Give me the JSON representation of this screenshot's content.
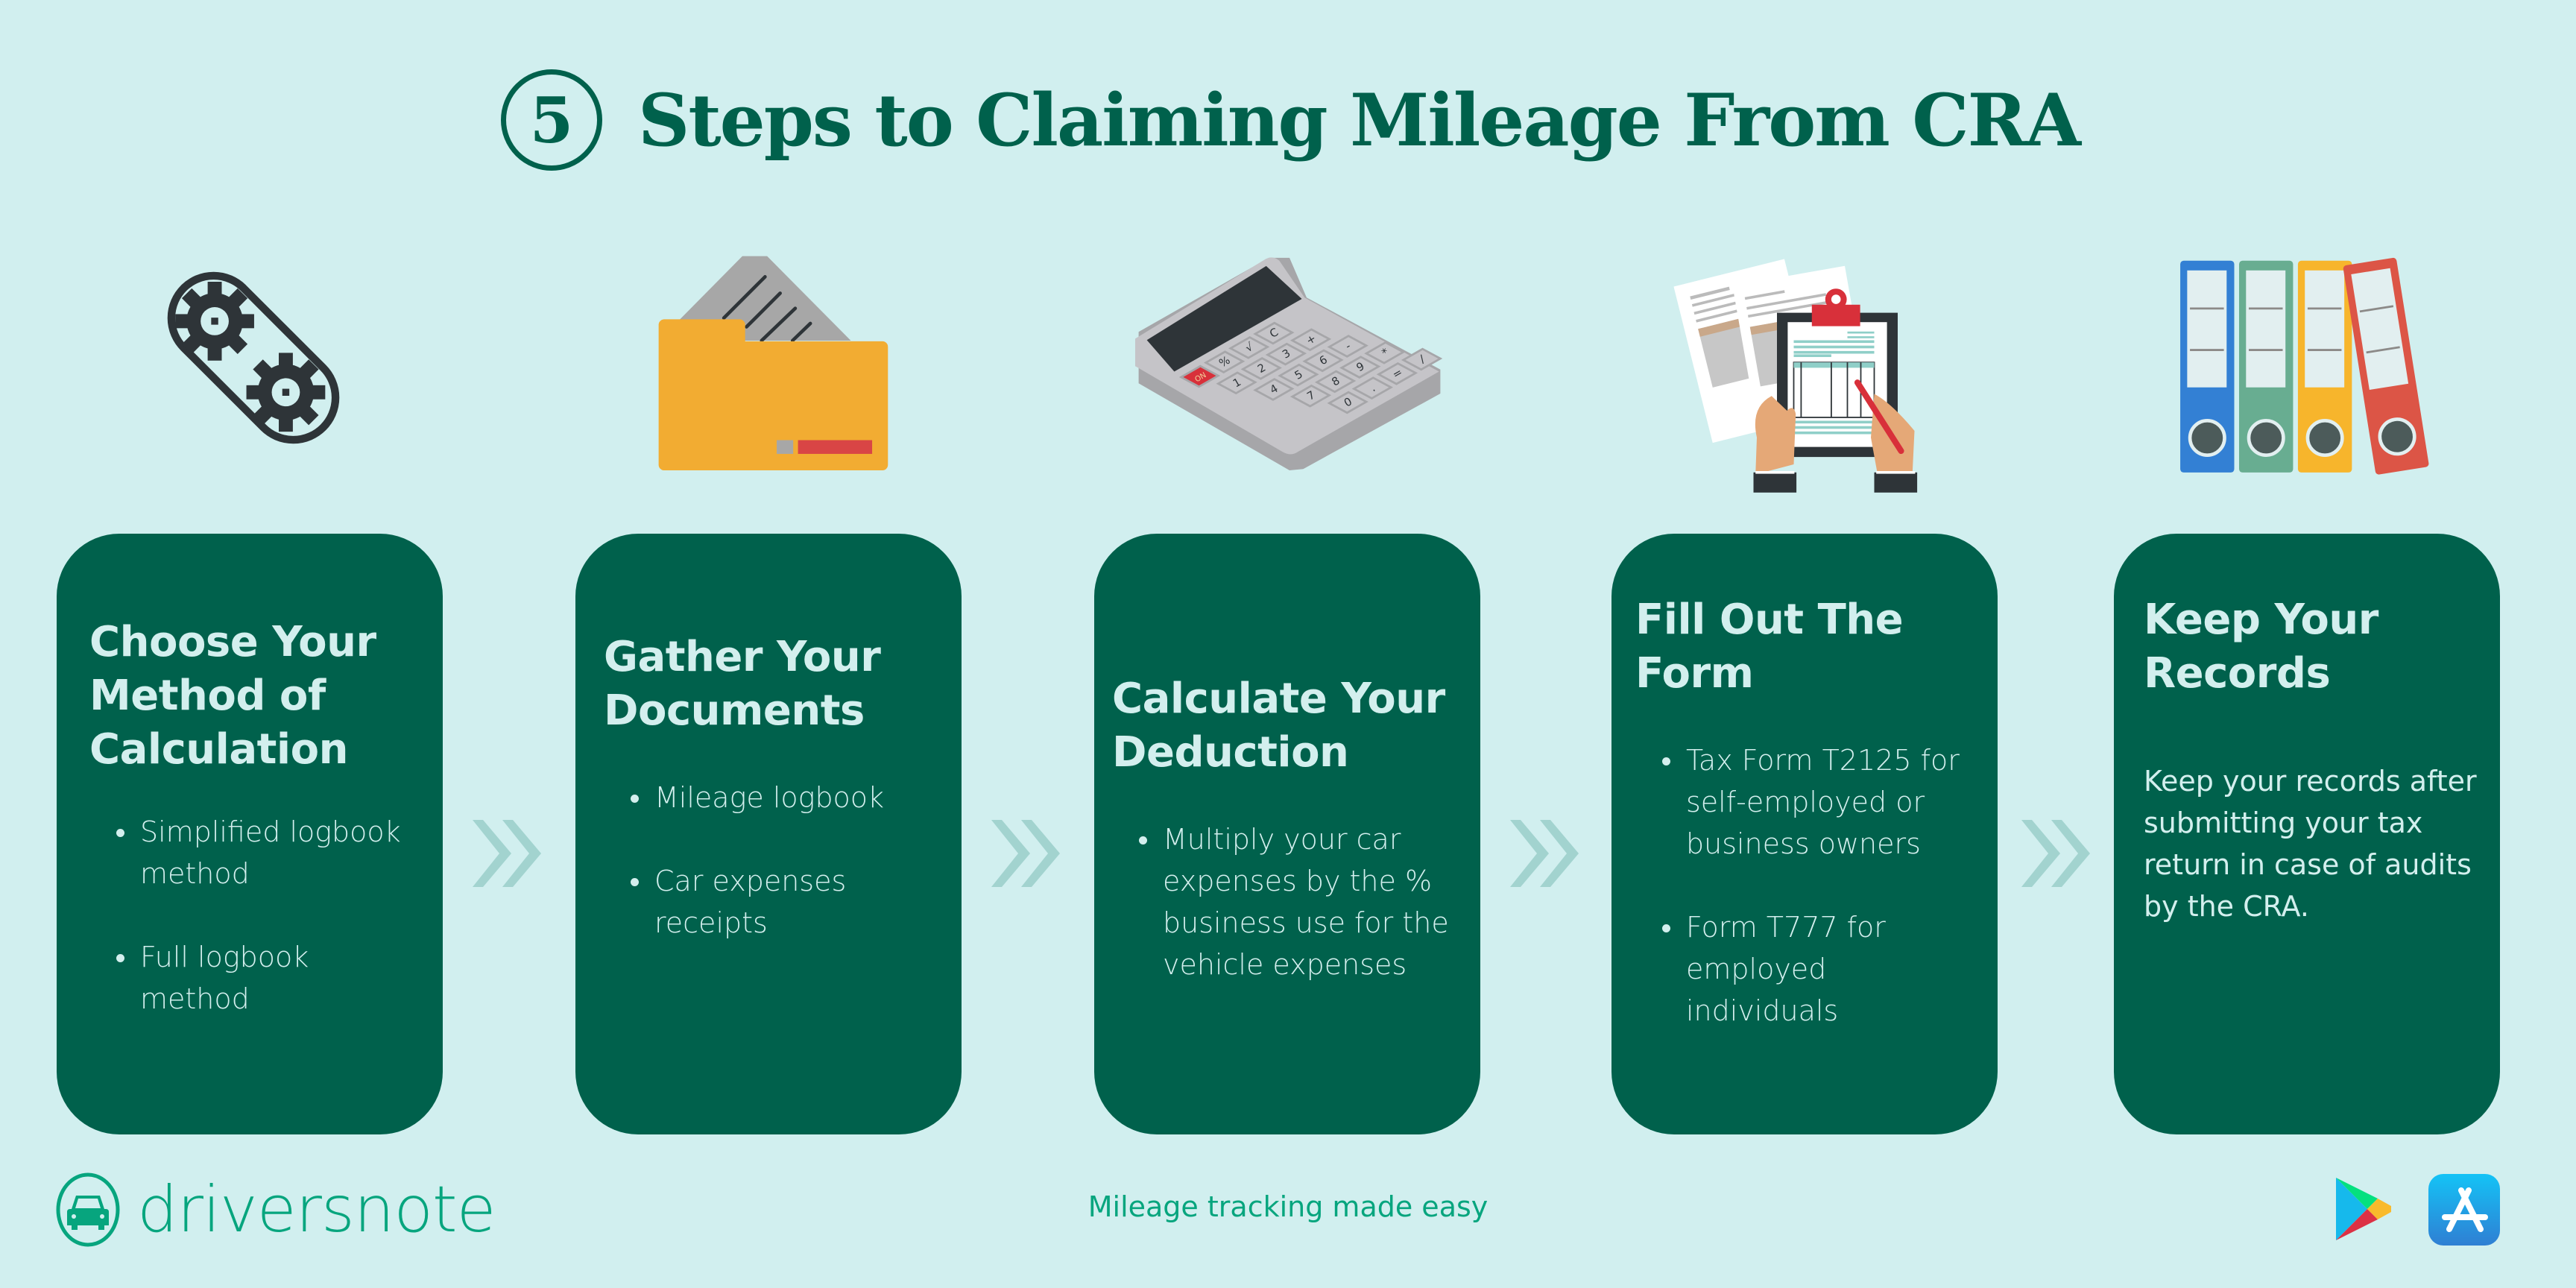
{
  "header": {
    "step_count": "5",
    "title": "Steps to Claiming Mileage From CRA"
  },
  "colors": {
    "background": "#d1efef",
    "card": "#00614c",
    "card_text": "#d3efee",
    "title": "#00614c",
    "brand_green": "#07a57e",
    "arrow": "#a2d3cf"
  },
  "steps": [
    {
      "icon": "gears-icon",
      "title": "Choose Your Method of Calculation",
      "bullets": [
        "Simplified logbook method",
        "Full logbook method"
      ]
    },
    {
      "icon": "folder-documents-icon",
      "title": "Gather Your Documents",
      "bullets": [
        "Mileage logbook",
        "Car expenses receipts"
      ]
    },
    {
      "icon": "calculator-icon",
      "title": "Calculate Your Deduction",
      "bullets": [
        "Multiply your car expenses by the % business use for the vehicle expenses"
      ]
    },
    {
      "icon": "clipboard-form-icon",
      "title": "Fill Out The Form",
      "bullets": [
        "Tax Form T2125 for self-employed or business owners",
        "Form T777 for employed individuals"
      ]
    },
    {
      "icon": "binders-icon",
      "title": "Keep Your Records",
      "paragraph": "Keep your records after submitting your tax return in case of audits by the CRA."
    }
  ],
  "calculator_keys": [
    "ON",
    "%",
    "√",
    "C",
    "1",
    "2",
    "3",
    "+",
    "4",
    "5",
    "6",
    "-",
    "7",
    "8",
    "9",
    "*",
    "0",
    ".",
    "=",
    "/"
  ],
  "footer": {
    "brand": "driversnote",
    "tagline": "Mileage tracking made easy",
    "stores": [
      "google-play-icon",
      "app-store-icon"
    ]
  }
}
